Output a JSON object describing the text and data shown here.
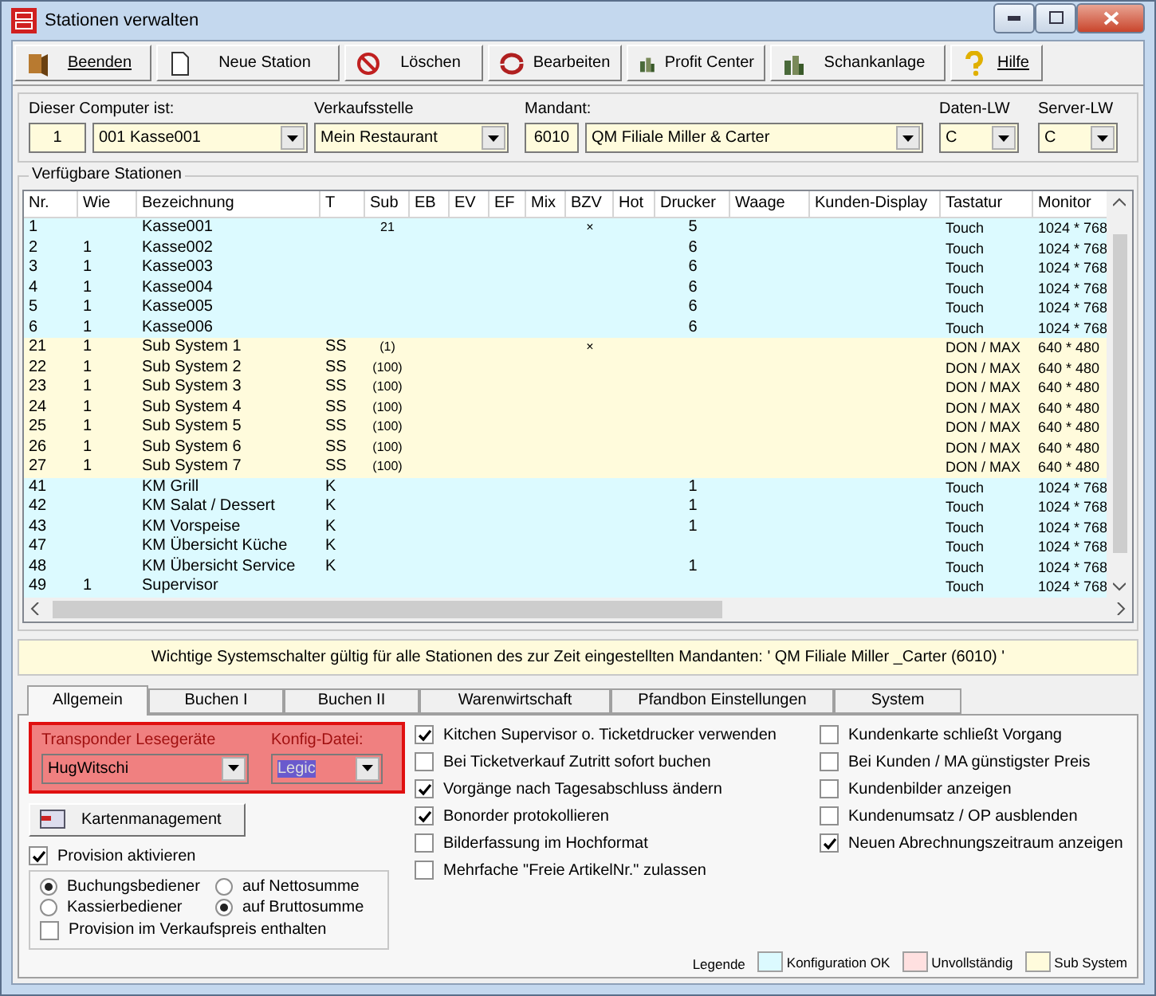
{
  "window": {
    "title": "Stationen verwalten"
  },
  "toolbar": [
    {
      "label": "Beenden",
      "underline": true
    },
    {
      "label": "Neue Station",
      "underline": false
    },
    {
      "label": "Löschen",
      "underline": false
    },
    {
      "label": "Bearbeiten",
      "underline": false
    },
    {
      "label": "Profit Center",
      "underline": false
    },
    {
      "label": "Schankanlage",
      "underline": false
    },
    {
      "label": "Hilfe",
      "underline": true
    }
  ],
  "header": {
    "computer_label": "Dieser Computer ist:",
    "computer_number": "1",
    "computer_name": "001  Kasse001",
    "verkaufsstelle_label": "Verkaufsstelle",
    "verkaufsstelle": "Mein Restaurant",
    "mandant_label": "Mandant:",
    "mandant_number": "6010",
    "mandant": "QM Filiale Miller & Carter",
    "daten_label": "Daten-LW",
    "daten": "C",
    "server_label": "Server-LW",
    "server": "C"
  },
  "stations": {
    "title": "Verfügbare Stationen",
    "columns": [
      "Nr.",
      "Wie",
      "Bezeichnung",
      "T",
      "Sub",
      "EB",
      "EV",
      "EF",
      "Mix",
      "BZV",
      "Hot",
      "Drucker",
      "Waage",
      "Kunden-Display",
      "Tastatur",
      "Monitor"
    ],
    "rows": [
      {
        "kind": "ok",
        "nr": "1",
        "name": "Kasse001",
        "sub": "21",
        "bzv": "×",
        "drucker": "5",
        "tastatur": "Touch",
        "monitor": "1024 * 768"
      },
      {
        "kind": "ok",
        "nr": "2",
        "wie": "1",
        "name": "Kasse002",
        "drucker": "6",
        "tastatur": "Touch",
        "monitor": "1024 * 768"
      },
      {
        "kind": "ok",
        "nr": "3",
        "wie": "1",
        "name": "Kasse003",
        "drucker": "6",
        "tastatur": "Touch",
        "monitor": "1024 * 768"
      },
      {
        "kind": "ok",
        "nr": "4",
        "wie": "1",
        "name": "Kasse004",
        "drucker": "6",
        "tastatur": "Touch",
        "monitor": "1024 * 768"
      },
      {
        "kind": "ok",
        "nr": "5",
        "wie": "1",
        "name": "Kasse005",
        "drucker": "6",
        "tastatur": "Touch",
        "monitor": "1024 * 768"
      },
      {
        "kind": "ok",
        "nr": "6",
        "wie": "1",
        "name": "Kasse006",
        "drucker": "6",
        "tastatur": "Touch",
        "monitor": "1024 * 768"
      },
      {
        "kind": "sub",
        "nr": "21",
        "wie": "1",
        "name": "Sub System 1",
        "t": "SS",
        "sub": "(1)",
        "bzv": "×",
        "tastatur": "DON / MAX",
        "monitor": "640 * 480"
      },
      {
        "kind": "sub",
        "nr": "22",
        "wie": "1",
        "name": "Sub System 2",
        "t": "SS",
        "sub": "(100)",
        "tastatur": "DON / MAX",
        "monitor": "640 * 480"
      },
      {
        "kind": "sub",
        "nr": "23",
        "wie": "1",
        "name": "Sub System 3",
        "t": "SS",
        "sub": "(100)",
        "tastatur": "DON / MAX",
        "monitor": "640 * 480"
      },
      {
        "kind": "sub",
        "nr": "24",
        "wie": "1",
        "name": "Sub System 4",
        "t": "SS",
        "sub": "(100)",
        "tastatur": "DON / MAX",
        "monitor": "640 * 480"
      },
      {
        "kind": "sub",
        "nr": "25",
        "wie": "1",
        "name": "Sub System 5",
        "t": "SS",
        "sub": "(100)",
        "tastatur": "DON / MAX",
        "monitor": "640 * 480"
      },
      {
        "kind": "sub",
        "nr": "26",
        "wie": "1",
        "name": "Sub System 6",
        "t": "SS",
        "sub": "(100)",
        "tastatur": "DON / MAX",
        "monitor": "640 * 480"
      },
      {
        "kind": "sub",
        "nr": "27",
        "wie": "1",
        "name": "Sub System 7",
        "t": "SS",
        "sub": "(100)",
        "tastatur": "DON / MAX",
        "monitor": "640 * 480"
      },
      {
        "kind": "ok",
        "nr": "41",
        "name": "KM Grill",
        "t": "K",
        "drucker": "1",
        "tastatur": "Touch",
        "monitor": "1024 * 768"
      },
      {
        "kind": "ok",
        "nr": "42",
        "name": "KM Salat / Dessert",
        "t": "K",
        "drucker": "1",
        "tastatur": "Touch",
        "monitor": "1024 * 768"
      },
      {
        "kind": "ok",
        "nr": "43",
        "name": "KM Vorspeise",
        "t": "K",
        "drucker": "1",
        "tastatur": "Touch",
        "monitor": "1024 * 768"
      },
      {
        "kind": "ok",
        "nr": "47",
        "name": "KM Übersicht Küche",
        "t": "K",
        "tastatur": "Touch",
        "monitor": "1024 * 768"
      },
      {
        "kind": "ok",
        "nr": "48",
        "name": "KM Übersicht Service",
        "t": "K",
        "drucker": "1",
        "tastatur": "Touch",
        "monitor": "1024 * 768"
      },
      {
        "kind": "ok",
        "nr": "49",
        "wie": "1",
        "name": "Supervisor",
        "tastatur": "Touch",
        "monitor": "1024 * 768"
      }
    ]
  },
  "notice": "Wichtige Systemschalter gültig für alle Stationen des zur Zeit eingestellten Mandanten: ' QM Filiale Miller _Carter (6010) '",
  "tabs": [
    {
      "label": "Allgemein",
      "selected": true
    },
    {
      "label": "Buchen I",
      "selected": false
    },
    {
      "label": "Buchen II",
      "selected": false
    },
    {
      "label": "Warenwirtschaft",
      "selected": false
    },
    {
      "label": "Pfandbon Einstellungen",
      "selected": false
    },
    {
      "label": "System",
      "selected": false
    }
  ],
  "transponder": {
    "label": "Transponder Lesegeräte",
    "value": "HugWitschi",
    "config_label": "Konfig-Datei:",
    "config_value": "Legic"
  },
  "card_button": "Kartenmanagement",
  "provision": {
    "label": "Provision aktivieren",
    "checked": true,
    "options": [
      {
        "label": "Buchungsbediener",
        "selected": true
      },
      {
        "label": "auf Nettosumme",
        "selected": false
      },
      {
        "label": "Kassierbediener",
        "selected": false
      },
      {
        "label": "auf Bruttosumme",
        "selected": true
      }
    ],
    "included": {
      "label": "Provision im Verkaufspreis enthalten",
      "checked": false
    }
  },
  "options_middle": [
    {
      "label": "Kitchen Supervisor o. Ticketdrucker verwenden",
      "checked": true
    },
    {
      "label": "Bei Ticketverkauf Zutritt sofort buchen",
      "checked": false
    },
    {
      "label": "Vorgänge nach Tagesabschluss ändern",
      "checked": true
    },
    {
      "label": "Bonorder protokollieren",
      "checked": true
    },
    {
      "label": "Bilderfassung im Hochformat",
      "checked": false
    },
    {
      "label": "Mehrfache \"Freie ArtikelNr.\" zulassen",
      "checked": false
    }
  ],
  "options_right": [
    {
      "label": "Kundenkarte schließt Vorgang",
      "checked": false
    },
    {
      "label": "Bei Kunden / MA günstigster Preis",
      "checked": false
    },
    {
      "label": "Kundenbilder anzeigen",
      "checked": false
    },
    {
      "label": "Kundenumsatz / OP ausblenden",
      "checked": false
    },
    {
      "label": "Neuen Abrechnungszeitraum anzeigen",
      "checked": true
    }
  ],
  "legend": {
    "label": "Legende",
    "items": [
      {
        "label": "Konfiguration OK",
        "color": "#dcfaff"
      },
      {
        "label": "Unvollständig",
        "color": "#ffe0e0"
      },
      {
        "label": "Sub System",
        "color": "#fffbdc"
      }
    ]
  }
}
